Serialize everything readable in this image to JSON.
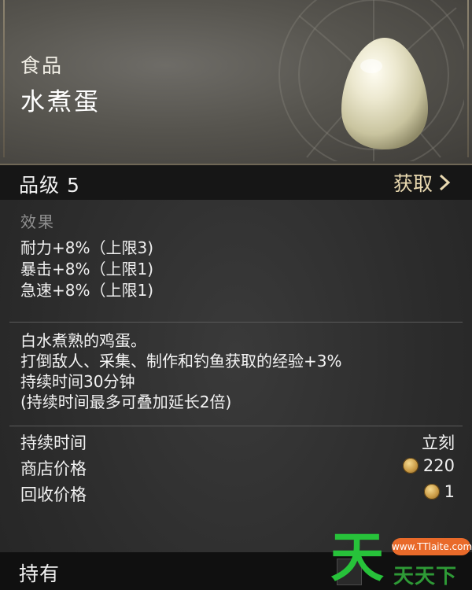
{
  "header": {
    "category": "食品",
    "item_name": "水煮蛋",
    "item_icon": "boiled-egg-icon"
  },
  "grade": {
    "label": "品级 5",
    "obtain_label": "获取",
    "obtain_icon": "chevron-right-icon"
  },
  "effects": {
    "title": "效果",
    "lines": [
      "耐力+8%（上限3)",
      "暴击+8%（上限1)",
      "急速+8%（上限1)"
    ]
  },
  "description": {
    "lines": [
      "白水煮熟的鸡蛋。",
      "打倒敌人、采集、制作和钓鱼获取的经验+3%",
      "持续时间30分钟",
      "(持续时间最多可叠加延长2倍)"
    ]
  },
  "stats": [
    {
      "label": "持续时间",
      "value": "立刻",
      "icon": ""
    },
    {
      "label": "商店价格",
      "value": "220",
      "icon": "gold-coin-icon"
    },
    {
      "label": "回收价格",
      "value": "1",
      "icon": "gold-coin-icon"
    }
  ],
  "footer": {
    "held_label": "持有"
  },
  "watermark": {
    "glyph": "天",
    "site": "www.TTlaite.com",
    "text": "天天下载"
  },
  "colors": {
    "obtain": "#e9d9b0",
    "effect_title": "#8f8f8f",
    "watermark_green": "#27c23a",
    "watermark_orange": "#e96a2a"
  }
}
